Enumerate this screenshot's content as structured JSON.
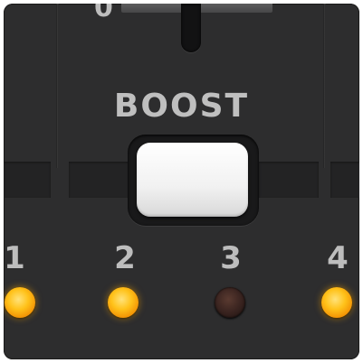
{
  "scale": {
    "digit": "0"
  },
  "boost": {
    "label": "BOOST"
  },
  "channels": [
    {
      "number": "1",
      "led": "on"
    },
    {
      "number": "2",
      "led": "on"
    },
    {
      "number": "3",
      "led": "off"
    },
    {
      "number": "4",
      "led": "on"
    }
  ],
  "colors": {
    "led_on": "#ffc21a",
    "led_off": "#3a2420",
    "panel": "#2d2d2e",
    "text": "#bfbfbf"
  }
}
